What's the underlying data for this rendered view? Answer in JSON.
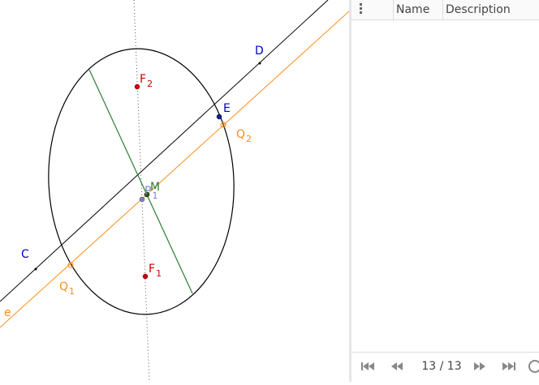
{
  "algebra_panel": {
    "columns": {
      "name": "Name",
      "description": "Description"
    }
  },
  "construction_nav": {
    "step_counter": "13 / 13"
  },
  "labels": {
    "C": "C",
    "D": "D",
    "E": "E",
    "M": "M",
    "P1_main": "P",
    "P1_sub": "1",
    "F1_main": "F",
    "F1_sub": "1",
    "F2_main": "F",
    "F2_sub": "2",
    "Q1_main": "Q",
    "Q1_sub": "1",
    "Q2_main": "Q",
    "Q2_sub": "2",
    "e": "e"
  },
  "colors": {
    "black_line": "#000000",
    "orange_line": "#ff8c1a",
    "green_line": "#2e7d32",
    "blue_label": "#0000cc",
    "red_point": "#cc0000",
    "lavender_point": "#8080cc"
  },
  "icons": {
    "menu": "vertical-dots-icon",
    "first": "skip-first-icon",
    "prev": "rewind-icon",
    "next": "fast-forward-icon",
    "last": "skip-last-icon",
    "play": "play-icon"
  }
}
